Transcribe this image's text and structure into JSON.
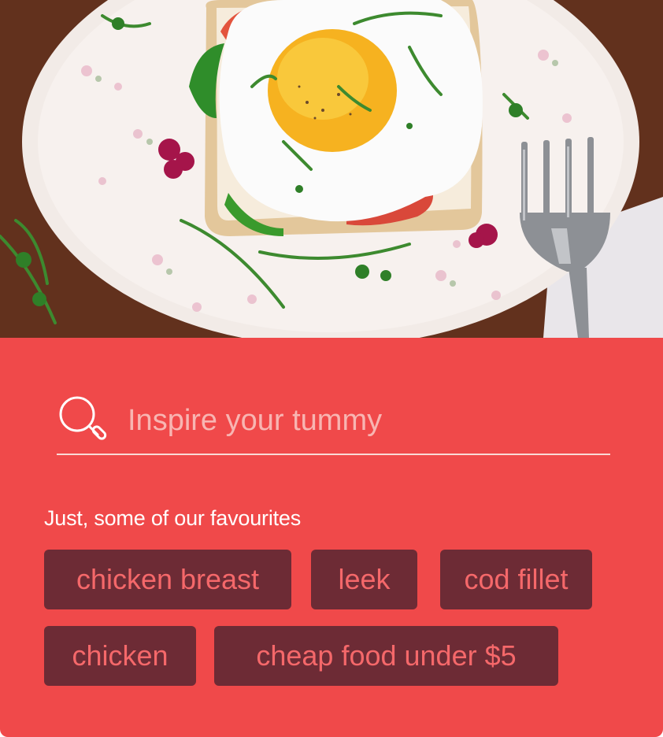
{
  "hero": {
    "image_description_icon": "fried-egg-toast-plate-image"
  },
  "search": {
    "placeholder": "Inspire your tummy",
    "value": "",
    "icon": "search-icon"
  },
  "favourites": {
    "heading": "Just, some of our favourites",
    "tags": [
      {
        "label": "chicken breast"
      },
      {
        "label": "leek"
      },
      {
        "label": "cod fillet"
      },
      {
        "label": "chicken"
      },
      {
        "label": "cheap food under $5"
      }
    ]
  },
  "colors": {
    "panel_background": "#f0494a",
    "tag_background": "#6d2b35",
    "tag_text": "#f5686a",
    "placeholder_text": "#f8b5b2",
    "underline": "#f9d9d6"
  }
}
